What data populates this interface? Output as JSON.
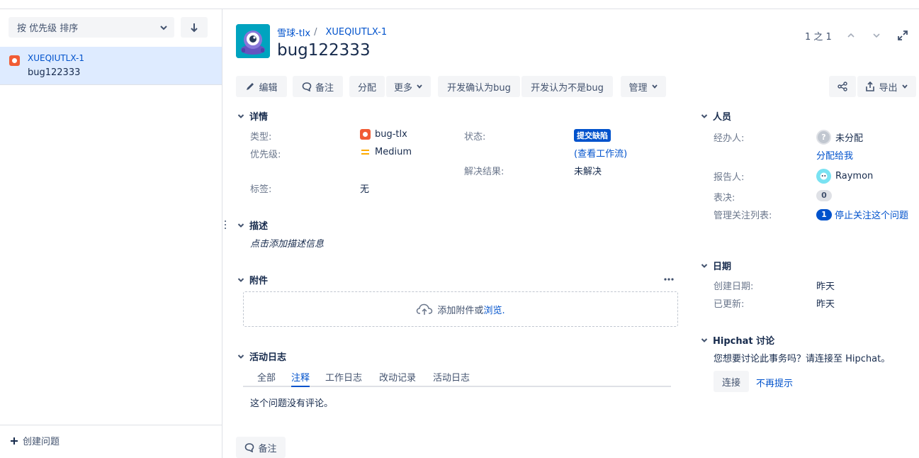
{
  "left_panel": {
    "sort_label": "按 优先级 排序",
    "issues": [
      {
        "key": "XUEQIUTLX-1",
        "summary": "bug122333"
      }
    ],
    "create_issue": "创建问题"
  },
  "header": {
    "project": "雪球-tlx",
    "issue_key": "XUEQIUTLX-1",
    "title": "bug122333",
    "pager": "1 之 1"
  },
  "toolbar": {
    "edit": "编辑",
    "comment": "备注",
    "assign": "分配",
    "more": "更多",
    "confirm_bug": "开发确认为bug",
    "not_bug": "开发认为不是bug",
    "admin": "管理",
    "export": "导出"
  },
  "details": {
    "heading": "详情",
    "type_label": "类型:",
    "type_value": "bug-tlx",
    "priority_label": "优先级:",
    "priority_value": "Medium",
    "labels_label": "标签:",
    "labels_value": "无",
    "status_label": "状态:",
    "status_value": "提交缺陷",
    "workflow_link": "(查看工作流)",
    "resolution_label": "解决结果:",
    "resolution_value": "未解决"
  },
  "description": {
    "heading": "描述",
    "placeholder": "点击添加描述信息"
  },
  "attachments": {
    "heading": "附件",
    "drop_text": "添加附件或",
    "browse": "浏览."
  },
  "activity": {
    "heading": "活动日志",
    "tabs": [
      "全部",
      "注释",
      "工作日志",
      "改动记录",
      "活动日志"
    ],
    "active_tab": "注释",
    "empty": "这个问题没有评论。",
    "comment_button": "备注"
  },
  "people": {
    "heading": "人员",
    "assignee_label": "经办人:",
    "assignee_value": "未分配",
    "assign_to_me": "分配给我",
    "reporter_label": "报告人:",
    "reporter_value": "Raymon",
    "votes_label": "表决:",
    "votes_value": "0",
    "watchers_label": "管理关注列表:",
    "watchers_count": "1",
    "watch_link": "停止关注这个问题"
  },
  "dates": {
    "heading": "日期",
    "created_label": "创建日期:",
    "created_value": "昨天",
    "updated_label": "已更新:",
    "updated_value": "昨天"
  },
  "hipchat": {
    "heading": "Hipchat 讨论",
    "prompt": "您想要讨论此事务吗？请连接至 Hipchat。",
    "connect": "连接",
    "dismiss": "不再提示"
  },
  "colors": {
    "link": "#0052cc",
    "selected_bg": "#deebff",
    "bug": "#f15c35",
    "status": "#0052cc",
    "button_bg": "#f4f5f7"
  }
}
